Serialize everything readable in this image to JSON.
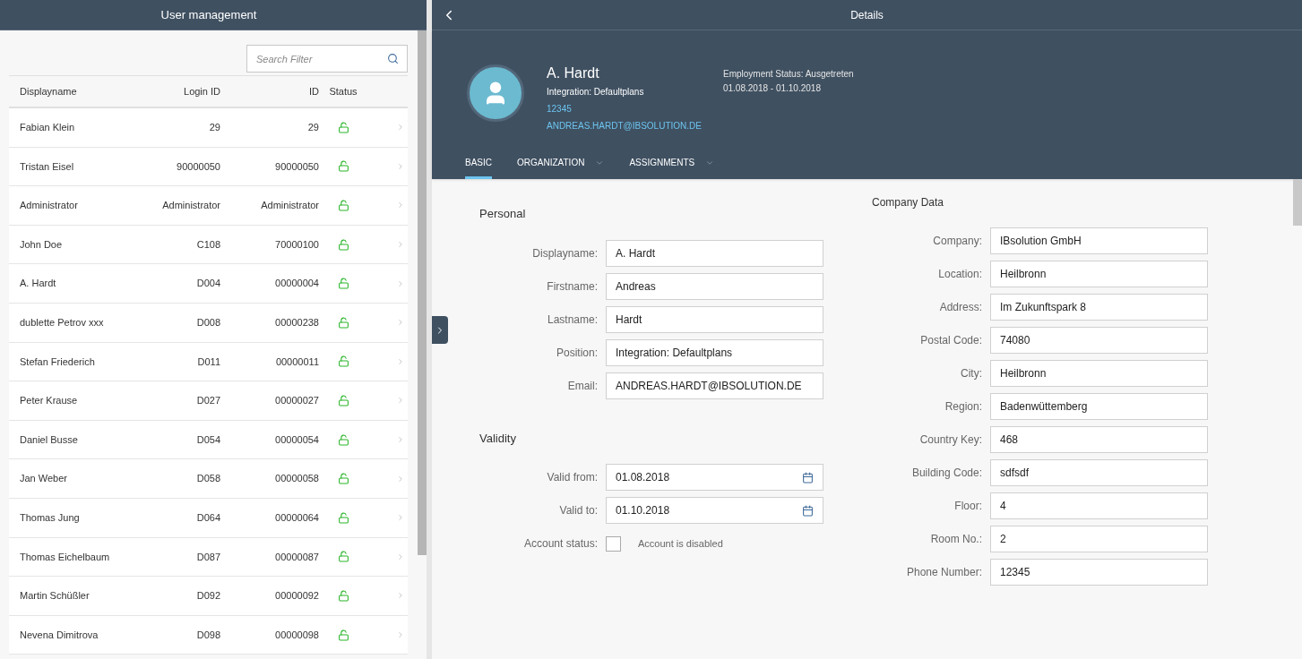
{
  "master": {
    "title": "User management",
    "search": {
      "placeholder": "Search Filter"
    },
    "columns": [
      "Displayname",
      "Login ID",
      "ID",
      "Status"
    ],
    "rows": [
      {
        "name": "Fabian Klein",
        "login_id": "29",
        "id": "29",
        "locked": false
      },
      {
        "name": "Tristan Eisel",
        "login_id": "90000050",
        "id": "90000050",
        "locked": false
      },
      {
        "name": "Administrator",
        "login_id": "Administrator",
        "id": "Administrator",
        "locked": false
      },
      {
        "name": "John Doe",
        "login_id": "C108",
        "id": "70000100",
        "locked": false
      },
      {
        "name": "A. Hardt",
        "login_id": "D004",
        "id": "00000004",
        "locked": false
      },
      {
        "name": "dublette Petrov xxx",
        "login_id": "D008",
        "id": "00000238",
        "locked": false
      },
      {
        "name": "Stefan Friederich",
        "login_id": "D011",
        "id": "00000011",
        "locked": false
      },
      {
        "name": "Peter Krause",
        "login_id": "D027",
        "id": "00000027",
        "locked": false
      },
      {
        "name": "Daniel Busse",
        "login_id": "D054",
        "id": "00000054",
        "locked": false
      },
      {
        "name": "Jan Weber",
        "login_id": "D058",
        "id": "00000058",
        "locked": false
      },
      {
        "name": "Thomas Jung",
        "login_id": "D064",
        "id": "00000064",
        "locked": false
      },
      {
        "name": "Thomas Eichelbaum",
        "login_id": "D087",
        "id": "00000087",
        "locked": false
      },
      {
        "name": "Martin Schüßler",
        "login_id": "D092",
        "id": "00000092",
        "locked": false
      },
      {
        "name": "Nevena Dimitrova",
        "login_id": "D098",
        "id": "00000098",
        "locked": false
      }
    ]
  },
  "detail": {
    "title": "Details",
    "header": {
      "name": "A. Hardt",
      "position": "Integration: Defaultplans",
      "phone": "12345",
      "email": "ANDREAS.HARDT@IBSOLUTION.DE",
      "employment_status": "Employment Status: Ausgetreten",
      "period": "01.08.2018 - 01.10.2018"
    },
    "tabs": [
      {
        "label": "BASIC",
        "selected": true,
        "kind": "plain"
      },
      {
        "label": "ORGANIZATION",
        "selected": false,
        "kind": "menu"
      },
      {
        "label": "ASSIGNMENTS",
        "selected": false,
        "kind": "menu"
      }
    ],
    "personal": {
      "title": "Personal",
      "fields": [
        {
          "label": "Displayname:",
          "value": "A. Hardt"
        },
        {
          "label": "Firstname:",
          "value": "Andreas"
        },
        {
          "label": "Lastname:",
          "value": "Hardt"
        },
        {
          "label": "Position:",
          "value": "Integration: Defaultplans"
        },
        {
          "label": "Email:",
          "value": "ANDREAS.HARDT@IBSOLUTION.DE"
        }
      ]
    },
    "validity": {
      "title": "Validity",
      "fields": [
        {
          "label": "Valid from:",
          "value": "01.08.2018",
          "kind": "date"
        },
        {
          "label": "Valid to:",
          "value": "01.10.2018",
          "kind": "date"
        }
      ],
      "account": {
        "label": "Account status:",
        "checked": false,
        "text": "Account is disabled"
      }
    },
    "company": {
      "title": "Company Data",
      "fields": [
        {
          "label": "Company:",
          "value": "IBsolution GmbH"
        },
        {
          "label": "Location:",
          "value": "Heilbronn"
        },
        {
          "label": "Address:",
          "value": "Im Zukunftspark 8"
        },
        {
          "label": "Postal Code:",
          "value": "74080"
        },
        {
          "label": "City:",
          "value": "Heilbronn"
        },
        {
          "label": "Region:",
          "value": "Badenwüttemberg"
        },
        {
          "label": "Country Key:",
          "value": "468"
        },
        {
          "label": "Building Code:",
          "value": "sdfsdf"
        },
        {
          "label": "Floor:",
          "value": "4"
        },
        {
          "label": "Room No.:",
          "value": "2"
        },
        {
          "label": "Phone Number:",
          "value": "12345"
        }
      ]
    }
  }
}
